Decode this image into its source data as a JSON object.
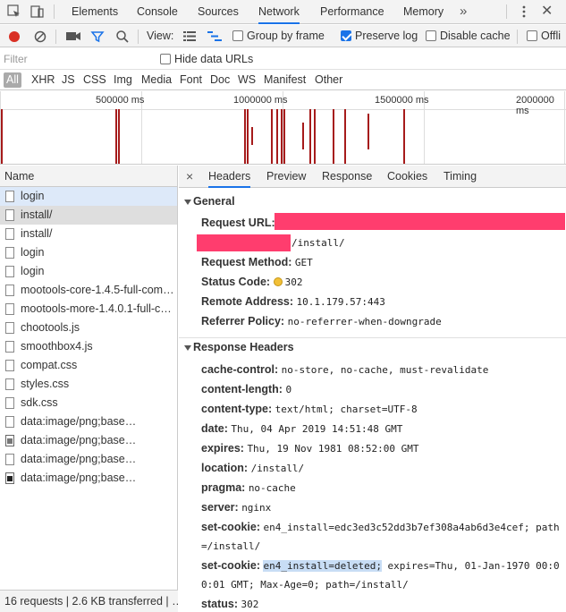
{
  "devtools_tabs": [
    "Elements",
    "Console",
    "Sources",
    "Network",
    "Performance",
    "Memory"
  ],
  "more_tabs_label": "»",
  "toolbar": {
    "view_label": "View:",
    "group_by_frame": "Group by frame",
    "preserve_log": "Preserve log",
    "disable_cache": "Disable cache",
    "offline": "Offli"
  },
  "filter": {
    "placeholder": "Filter",
    "hide_data_urls": "Hide data URLs"
  },
  "types": [
    "All",
    "XHR",
    "JS",
    "CSS",
    "Img",
    "Media",
    "Font",
    "Doc",
    "WS",
    "Manifest",
    "Other"
  ],
  "overview": {
    "labels": [
      "500000 ms",
      "1000000 ms",
      "1500000 ms",
      "2000000 ms"
    ]
  },
  "list": {
    "header": "Name",
    "rows": [
      "login",
      "install/",
      "install/",
      "login",
      "login",
      "mootools-core-1.4.5-full-com…",
      "mootools-more-1.4.0.1-full-c…",
      "chootools.js",
      "smoothbox4.js",
      "compat.css",
      "styles.css",
      "sdk.css",
      "data:image/png;base…",
      "data:image/png;base…",
      "data:image/png;base…",
      "data:image/png;base…"
    ],
    "status": "16 requests | 2.6 KB transferred | …"
  },
  "detail": {
    "close": "×",
    "tabs": [
      "Headers",
      "Preview",
      "Response",
      "Cookies",
      "Timing"
    ],
    "general": {
      "title": "General",
      "request_url_label": "Request URL:",
      "request_url_suffix": "/install/",
      "request_method_label": "Request Method:",
      "request_method": "GET",
      "status_code_label": "Status Code:",
      "status_code": "302",
      "remote_address_label": "Remote Address:",
      "remote_address": "10.1.179.57:443",
      "referrer_policy_label": "Referrer Policy:",
      "referrer_policy": "no-referrer-when-downgrade"
    },
    "response_headers": {
      "title": "Response Headers",
      "items": [
        {
          "k": "cache-control:",
          "v": "no-store, no-cache, must-revalidate"
        },
        {
          "k": "content-length:",
          "v": "0"
        },
        {
          "k": "content-type:",
          "v": "text/html; charset=UTF-8"
        },
        {
          "k": "date:",
          "v": "Thu, 04 Apr 2019 14:51:48 GMT"
        },
        {
          "k": "expires:",
          "v": "Thu, 19 Nov 1981 08:52:00 GMT"
        },
        {
          "k": "location:",
          "v": "/install/"
        },
        {
          "k": "pragma:",
          "v": "no-cache"
        },
        {
          "k": "server:",
          "v": "nginx"
        }
      ],
      "cookie1_label": "set-cookie:",
      "cookie1_line1": "en4_install=edc3ed3c52dd3b7ef308a4ab6d3e4cef; path",
      "cookie1_line2": "=/install/",
      "cookie2_label": "set-cookie:",
      "cookie2_selected": "en4_install=deleted;",
      "cookie2_line1_rest": " expires=Thu, 01-Jan-1970 00:0",
      "cookie2_line2": "0:01 GMT; Max-Age=0; path=/install/",
      "status_label": "status:",
      "status_value": "302"
    }
  },
  "colors": {
    "accent": "#1a73e8",
    "redaction": "#ff3d6e",
    "timeline_bar": "#a61b1b",
    "record": "#d93025"
  }
}
